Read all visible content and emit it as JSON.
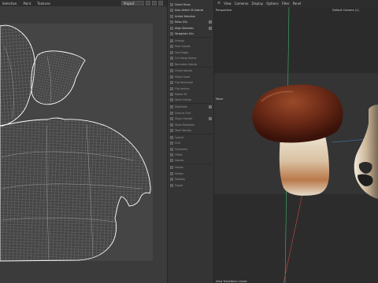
{
  "uv_editor": {
    "menu": [
      "Selection",
      "Paint",
      "Textures"
    ],
    "project_select": "Project",
    "boundary_color": "#ffffff",
    "mesh_color": "#8a8a8a",
    "background": "#3b3b3b"
  },
  "middle_panel": {
    "items": [
      {
        "label": "Select Faces",
        "checked": false
      },
      {
        "label": "Auto-Select UV Islands",
        "checked": false
      },
      {
        "label": "Unfold Selection",
        "checked": false
      },
      {
        "label": "Relax UVs",
        "checked": true
      },
      {
        "label": "Align Selection",
        "checked": true
      },
      {
        "label": "Straighten UVs",
        "checked": false
      },
      {
        "label": "Unwrap",
        "checked": false
      },
      {
        "label": "Pack Islands",
        "checked": false
      },
      {
        "label": "Sew Edges",
        "checked": false
      },
      {
        "label": "Cut Along Seams",
        "checked": false
      },
      {
        "label": "Normalize Islands",
        "checked": false
      },
      {
        "label": "Orient Islands",
        "checked": false
      },
      {
        "label": "Match Scale",
        "checked": false
      },
      {
        "label": "Flip Horizontal",
        "checked": false
      },
      {
        "label": "Flip Vertical",
        "checked": false
      },
      {
        "label": "Rotate 90",
        "checked": false
      },
      {
        "label": "Stack Similar",
        "checked": false
      },
      {
        "label": "Distribute",
        "checked": true
      },
      {
        "label": "Snap to Grid",
        "checked": false
      },
      {
        "label": "Show Checker",
        "checked": true
      },
      {
        "label": "Show Distortion",
        "checked": false
      },
      {
        "label": "Texel Density",
        "checked": false
      },
      {
        "label": "Layout",
        "checked": false
      },
      {
        "label": "Grid",
        "checked": false
      },
      {
        "label": "Symmetry",
        "checked": false
      },
      {
        "label": "Offset",
        "checked": false
      },
      {
        "label": "Islands",
        "checked": false
      },
      {
        "label": "Seams",
        "checked": false
      },
      {
        "label": "Margin",
        "checked": false
      },
      {
        "label": "Padding",
        "checked": false
      },
      {
        "label": "Export",
        "checked": false
      }
    ]
  },
  "viewport": {
    "menu": [
      "View",
      "Cameras",
      "Display",
      "Options",
      "Filter",
      "Panel"
    ],
    "perspective_label": "Perspective",
    "camera_label": "Default Camera (1)",
    "mode_label": "Move",
    "footer_label": "View Transform: Linear",
    "axis_y_color": "#3db86a",
    "axis_x_color": "#c94a4a",
    "axis_z_color": "#4a86c9",
    "cap_color": "#6b2a17",
    "stem_color": "#d9cdb8"
  }
}
